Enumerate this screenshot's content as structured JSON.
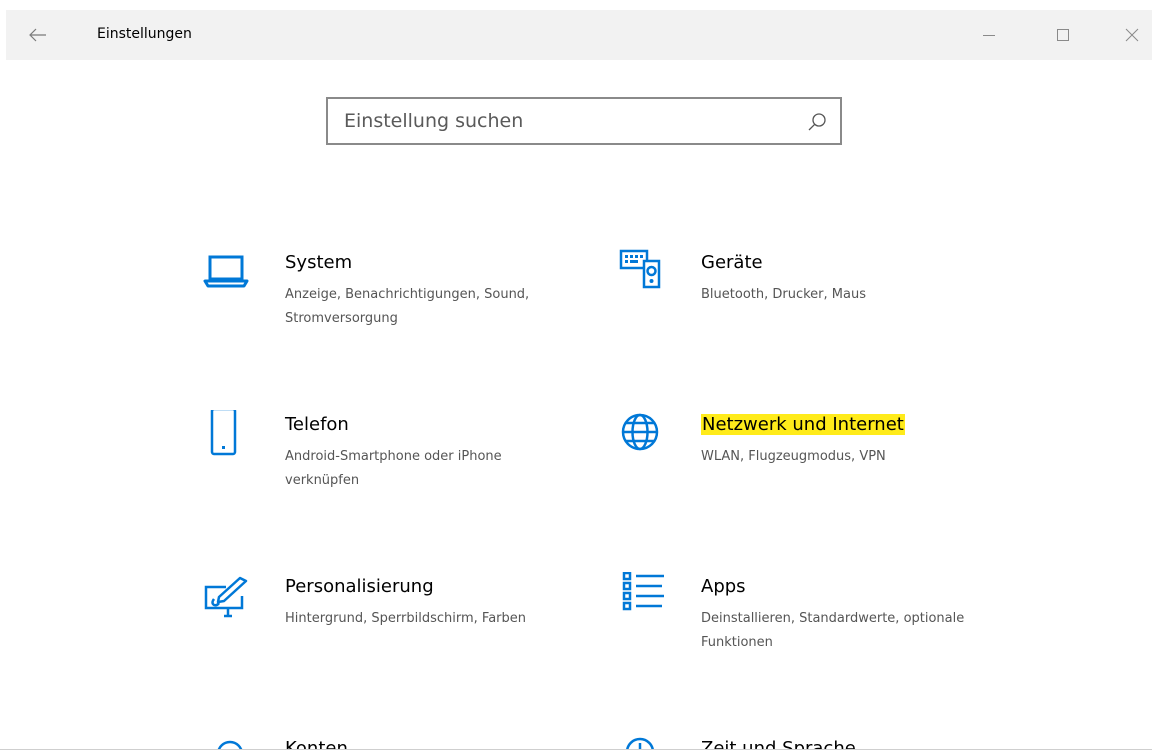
{
  "window": {
    "title": "Einstellungen",
    "back_icon": "arrow-left-icon",
    "minimize_icon": "minimize-icon",
    "maximize_icon": "maximize-icon",
    "close_icon": "close-icon"
  },
  "search": {
    "placeholder": "Einstellung suchen",
    "icon": "search-icon"
  },
  "colors": {
    "accent": "#0078d7",
    "highlight": "#ffeb1a"
  },
  "categories": [
    {
      "name": "System",
      "description": "Anzeige, Benachrichtigungen, Sound, Stromversorgung",
      "icon": "laptop-icon"
    },
    {
      "name": "Geräte",
      "description": "Bluetooth, Drucker, Maus",
      "icon": "devices-icon"
    },
    {
      "name": "Telefon",
      "description": "Android-Smartphone oder iPhone verknüpfen",
      "icon": "phone-icon"
    },
    {
      "name": "Netzwerk und Internet",
      "description": "WLAN, Flugzeugmodus, VPN",
      "icon": "globe-icon",
      "highlighted": true
    },
    {
      "name": "Personalisierung",
      "description": "Hintergrund, Sperrbildschirm, Farben",
      "icon": "personalization-icon"
    },
    {
      "name": "Apps",
      "description": "Deinstallieren, Standardwerte, optionale Funktionen",
      "icon": "apps-list-icon"
    },
    {
      "name": "Konten",
      "description": "",
      "icon": "account-icon"
    },
    {
      "name": "Zeit und Sprache",
      "description": "",
      "icon": "clock-icon"
    }
  ]
}
